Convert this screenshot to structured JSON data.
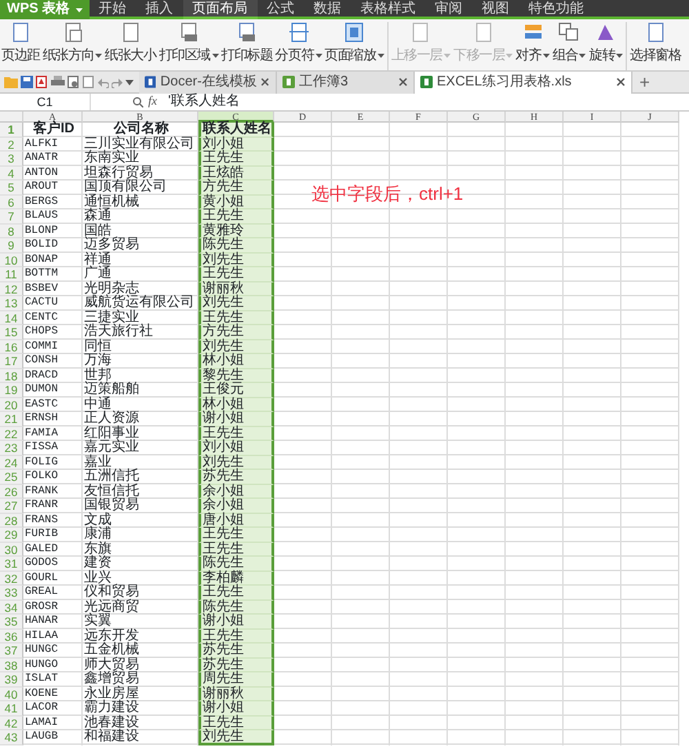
{
  "app_menu": {
    "label": "WPS 表格"
  },
  "menu_tabs": [
    {
      "label": "开始",
      "selected": false
    },
    {
      "label": "插入",
      "selected": false
    },
    {
      "label": "页面布局",
      "selected": true
    },
    {
      "label": "公式",
      "selected": false
    },
    {
      "label": "数据",
      "selected": false
    },
    {
      "label": "表格样式",
      "selected": false
    },
    {
      "label": "审阅",
      "selected": false
    },
    {
      "label": "视图",
      "selected": false
    },
    {
      "label": "特色功能",
      "selected": false
    }
  ],
  "ribbon": [
    {
      "label": "页边距",
      "dropdown": false,
      "disabled": false
    },
    {
      "label": "纸张方向",
      "dropdown": true,
      "disabled": false
    },
    {
      "label": "纸张大小",
      "dropdown": false,
      "disabled": false
    },
    {
      "label": "打印区域",
      "dropdown": true,
      "disabled": false
    },
    {
      "label": "打印标题",
      "dropdown": false,
      "disabled": false
    },
    {
      "label": "分页符",
      "dropdown": true,
      "disabled": false
    },
    {
      "label": "页面缩放",
      "dropdown": true,
      "disabled": false
    },
    {
      "label": "上移一层",
      "dropdown": true,
      "disabled": true
    },
    {
      "label": "下移一层",
      "dropdown": true,
      "disabled": true
    },
    {
      "label": "对齐",
      "dropdown": true,
      "disabled": false
    },
    {
      "label": "组合",
      "dropdown": true,
      "disabled": false
    },
    {
      "label": "旋转",
      "dropdown": true,
      "disabled": false
    },
    {
      "label": "选择窗格",
      "dropdown": false,
      "disabled": false
    }
  ],
  "doc_tabs": [
    {
      "label": "Docer-在线模板",
      "selected": false
    },
    {
      "label": "工作簿3",
      "selected": false
    },
    {
      "label": "EXCEL练习用表格.xls",
      "selected": true
    }
  ],
  "new_tab": "+",
  "formula_bar": {
    "cell_ref": "C1",
    "fx": "fx",
    "content": "'联系人姓名"
  },
  "columns": [
    {
      "label": "A",
      "selected": false
    },
    {
      "label": "B",
      "selected": false
    },
    {
      "label": "C",
      "selected": true
    },
    {
      "label": "D",
      "selected": false
    },
    {
      "label": "E",
      "selected": false
    },
    {
      "label": "F",
      "selected": false
    },
    {
      "label": "G",
      "selected": false
    },
    {
      "label": "H",
      "selected": false
    },
    {
      "label": "I",
      "selected": false
    },
    {
      "label": "J",
      "selected": false
    }
  ],
  "rows": [
    {
      "number": "1",
      "kind": "header",
      "cells": [
        "客户ID",
        "公司名称",
        "联系人姓名"
      ]
    },
    {
      "number": "2",
      "kind": "data",
      "cells": [
        "ALFKI",
        "三川实业有限公司",
        "刘小姐"
      ]
    },
    {
      "number": "3",
      "kind": "data",
      "cells": [
        "ANATR",
        "东南实业",
        "王先生"
      ]
    },
    {
      "number": "4",
      "kind": "data",
      "cells": [
        "ANTON",
        "坦森行贸易",
        "王炫皓"
      ]
    },
    {
      "number": "5",
      "kind": "data",
      "cells": [
        "AROUT",
        "国顶有限公司",
        "方先生"
      ]
    },
    {
      "number": "6",
      "kind": "data",
      "cells": [
        "BERGS",
        "通恒机械",
        "黄小姐"
      ]
    },
    {
      "number": "7",
      "kind": "data",
      "cells": [
        "BLAUS",
        "森通",
        "王先生"
      ]
    },
    {
      "number": "8",
      "kind": "data",
      "cells": [
        "BLONP",
        "国皓",
        "黄雅玲"
      ]
    },
    {
      "number": "9",
      "kind": "data",
      "cells": [
        "BOLID",
        "迈多贸易",
        "陈先生"
      ]
    },
    {
      "number": "10",
      "kind": "data",
      "cells": [
        "BONAP",
        "祥通",
        "刘先生"
      ]
    },
    {
      "number": "11",
      "kind": "data",
      "cells": [
        "BOTTM",
        "广通",
        "王先生"
      ]
    },
    {
      "number": "12",
      "kind": "data",
      "cells": [
        "BSBEV",
        "光明杂志",
        "谢丽秋"
      ]
    },
    {
      "number": "13",
      "kind": "data",
      "cells": [
        "CACTU",
        "威航货运有限公司",
        "刘先生"
      ]
    },
    {
      "number": "14",
      "kind": "data",
      "cells": [
        "CENTC",
        "三捷实业",
        "王先生"
      ]
    },
    {
      "number": "15",
      "kind": "data",
      "cells": [
        "CHOPS",
        "浩天旅行社",
        "方先生"
      ]
    },
    {
      "number": "16",
      "kind": "data",
      "cells": [
        "COMMI",
        "同恒",
        "刘先生"
      ]
    },
    {
      "number": "17",
      "kind": "data",
      "cells": [
        "CONSH",
        "万海",
        "林小姐"
      ]
    },
    {
      "number": "18",
      "kind": "data",
      "cells": [
        "DRACD",
        "世邦",
        "黎先生"
      ]
    },
    {
      "number": "19",
      "kind": "data",
      "cells": [
        "DUMON",
        "迈策船舶",
        "王俊元"
      ]
    },
    {
      "number": "20",
      "kind": "data",
      "cells": [
        "EASTC",
        "中通",
        "林小姐"
      ]
    },
    {
      "number": "21",
      "kind": "data",
      "cells": [
        "ERNSH",
        "正人资源",
        "谢小姐"
      ]
    },
    {
      "number": "22",
      "kind": "data",
      "cells": [
        "FAMIA",
        "红阳事业",
        "王先生"
      ]
    },
    {
      "number": "23",
      "kind": "data",
      "cells": [
        "FISSA",
        "嘉元实业",
        "刘小姐"
      ]
    },
    {
      "number": "24",
      "kind": "data",
      "cells": [
        "FOLIG",
        "嘉业",
        "刘先生"
      ]
    },
    {
      "number": "25",
      "kind": "data",
      "cells": [
        "FOLKO",
        "五洲信托",
        "苏先生"
      ]
    },
    {
      "number": "26",
      "kind": "data",
      "cells": [
        "FRANK",
        "友恒信托",
        "余小姐"
      ]
    },
    {
      "number": "27",
      "kind": "data",
      "cells": [
        "FRANR",
        "国银贸易",
        "余小姐"
      ]
    },
    {
      "number": "28",
      "kind": "data",
      "cells": [
        "FRANS",
        "文成",
        "唐小姐"
      ]
    },
    {
      "number": "29",
      "kind": "data",
      "cells": [
        "FURIB",
        "康浦",
        "王先生"
      ]
    },
    {
      "number": "30",
      "kind": "data",
      "cells": [
        "GALED",
        "东旗",
        "王先生"
      ]
    },
    {
      "number": "31",
      "kind": "data",
      "cells": [
        "GODOS",
        "建资",
        "陈先生"
      ]
    },
    {
      "number": "32",
      "kind": "data",
      "cells": [
        "GOURL",
        "业兴",
        "李柏麟"
      ]
    },
    {
      "number": "33",
      "kind": "data",
      "cells": [
        "GREAL",
        "仪和贸易",
        "王先生"
      ]
    },
    {
      "number": "34",
      "kind": "data",
      "cells": [
        "GROSR",
        "光远商贸",
        "陈先生"
      ]
    },
    {
      "number": "35",
      "kind": "data",
      "cells": [
        "HANAR",
        "实翼",
        "谢小姐"
      ]
    },
    {
      "number": "36",
      "kind": "data",
      "cells": [
        "HILAA",
        "远东开发",
        "王先生"
      ]
    },
    {
      "number": "37",
      "kind": "data",
      "cells": [
        "HUNGC",
        "五金机械",
        "苏先生"
      ]
    },
    {
      "number": "38",
      "kind": "data",
      "cells": [
        "HUNGO",
        "师大贸易",
        "苏先生"
      ]
    },
    {
      "number": "39",
      "kind": "data",
      "cells": [
        "ISLAT",
        "鑫增贸易",
        "周先生"
      ]
    },
    {
      "number": "40",
      "kind": "data",
      "cells": [
        "KOENE",
        "永业房屋",
        "谢丽秋"
      ]
    },
    {
      "number": "41",
      "kind": "data",
      "cells": [
        "LACOR",
        "霸力建设",
        "谢小姐"
      ]
    },
    {
      "number": "42",
      "kind": "data",
      "cells": [
        "LAMAI",
        "池春建设",
        "王先生"
      ]
    },
    {
      "number": "43",
      "kind": "data",
      "cells": [
        "LAUGB",
        "和福建设",
        "刘先生"
      ]
    }
  ],
  "annotation": "选中字段后，ctrl+1"
}
